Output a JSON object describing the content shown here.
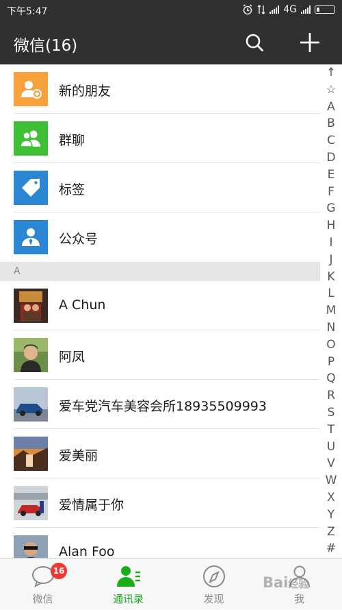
{
  "status_bar": {
    "time": "下午5:47",
    "network": "4G"
  },
  "header": {
    "title": "微信(16)"
  },
  "icon_names": [
    "search-icon",
    "plus-icon",
    "new-friends-icon",
    "group-chat-icon",
    "tag-icon",
    "official-accounts-icon",
    "chat-bubble-icon",
    "contacts-icon",
    "compass-icon",
    "person-icon"
  ],
  "colors": {
    "header_bg": "#2f3032",
    "accent_green": "#1aad19",
    "new_friends": "#f6a13b",
    "group_chat": "#3fbf35",
    "tags": "#2b87d3",
    "official": "#2b87d3",
    "badge": "#f43530"
  },
  "shortcuts": [
    {
      "label": "新的朋友"
    },
    {
      "label": "群聊"
    },
    {
      "label": "标签"
    },
    {
      "label": "公众号"
    }
  ],
  "section_header": "A",
  "contacts": [
    {
      "name": "A Chun"
    },
    {
      "name": "阿凤"
    },
    {
      "name": "爱车党汽车美容会所18935509993"
    },
    {
      "name": "爱美丽"
    },
    {
      "name": "爱情属于你"
    },
    {
      "name": "Alan Foo"
    }
  ],
  "index_letters": [
    "↑",
    "☆",
    "A",
    "B",
    "C",
    "D",
    "E",
    "F",
    "G",
    "H",
    "I",
    "J",
    "K",
    "L",
    "M",
    "N",
    "O",
    "P",
    "Q",
    "R",
    "S",
    "T",
    "U",
    "V",
    "W",
    "X",
    "Y",
    "Z",
    "#"
  ],
  "tabs": [
    {
      "label": "微信",
      "badge": "16",
      "active": false
    },
    {
      "label": "通讯录",
      "active": true
    },
    {
      "label": "发现",
      "active": false
    },
    {
      "label": "我",
      "active": false
    }
  ]
}
